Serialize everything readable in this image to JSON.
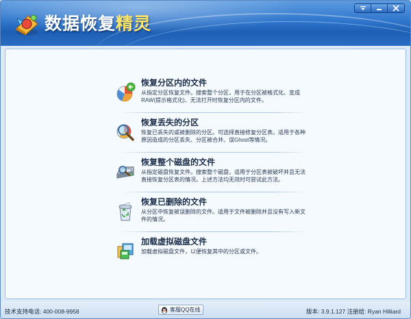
{
  "window": {
    "title_main": "数据恢复",
    "title_highlight": "精灵"
  },
  "options": [
    {
      "title": "恢复分区内的文件",
      "desc_line1": "从指定分区恢复文件。搜索整个分区，用于在分区被格式化、变成",
      "desc_line2": "RAW(提示格式化)、无法打开时恢复分区内的文件。",
      "icon": "pie-restore-icon"
    },
    {
      "title": "恢复丢失的分区",
      "desc_line1": "恢复已丢失的或被删除的分区。可选择直接修复分区表。适用于各种",
      "desc_line2": "原因造成的分区丢失、分区被合并、误Ghost等情况。",
      "icon": "magnifier-disk-icon"
    },
    {
      "title": "恢复整个磁盘的文件",
      "desc_line1": "从指定磁盘恢复文件。搜索整个磁盘，适用于分区表被破坏并且无法",
      "desc_line2": "直接恢复分区表的情况。上述方法均无效时可尝试此方法。",
      "icon": "hard-disk-icon"
    },
    {
      "title": "恢复已删除的文件",
      "desc_line1": "从分区中恢复被误删除的文件。适用于文件被删除并且没有写入新文",
      "desc_line2": "件的情况。",
      "icon": "recycle-bin-icon"
    },
    {
      "title": "加载虚拟磁盘文件",
      "desc_line1": "加载虚拟磁盘文件，以便恢复其中的分区或文件。",
      "desc_line2": "",
      "icon": "virtual-disk-icon"
    }
  ],
  "statusbar": {
    "support": "技术支持电话: 400-008-9958",
    "qq_button": "客服QQ在线",
    "version": "版本: 3.9.1.127  注册给:  Ryan Hilliard"
  },
  "colors": {
    "header": "#2f76cc",
    "title_highlight": "#ffe46a",
    "panel": "#f5faff"
  }
}
